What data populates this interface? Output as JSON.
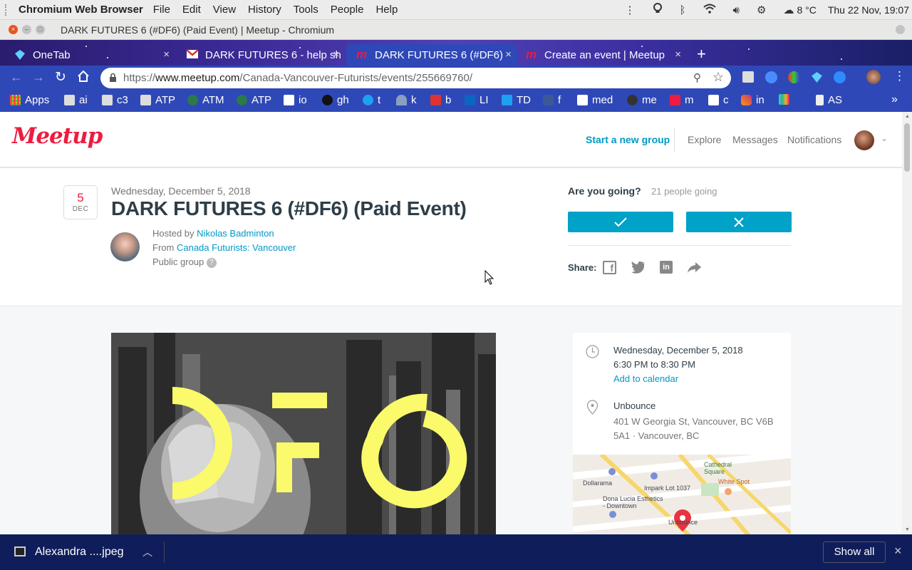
{
  "system": {
    "app_name": "Chromium Web Browser",
    "menus": [
      "File",
      "Edit",
      "View",
      "History",
      "Tools",
      "People",
      "Help"
    ],
    "temperature": "8 °C",
    "datetime": "Thu 22 Nov, 19:07"
  },
  "window": {
    "title": "DARK FUTURES 6 (#DF6) (Paid Event) | Meetup - Chromium"
  },
  "tabs": [
    {
      "label": "OneTab",
      "icon": "onetab-icon",
      "active": false
    },
    {
      "label": "DARK FUTURES 6 - help sh",
      "icon": "gmail-icon",
      "active": false
    },
    {
      "label": "DARK FUTURES 6 (#DF6) (",
      "icon": "meetup-icon",
      "active": true
    },
    {
      "label": "Create an event | Meetup",
      "icon": "meetup-icon",
      "active": false
    }
  ],
  "omnibox": {
    "scheme": "https://",
    "host": "www.meetup.com",
    "path": "/Canada-Vancouver-Futurists/events/255669760/"
  },
  "bookmarks": [
    "Apps",
    "ai",
    "c3",
    "ATP",
    "ATM",
    "ATP",
    "io",
    "gh",
    "t",
    "k",
    "b",
    "LI",
    "TD",
    "f",
    "med",
    "me",
    "m",
    "c",
    "in",
    "",
    "AS"
  ],
  "meetup": {
    "logo": "Meetup",
    "nav": {
      "start_group": "Start a new group",
      "explore": "Explore",
      "messages": "Messages",
      "notifications": "Notifications"
    },
    "event": {
      "date_day": "5",
      "date_month": "DEC",
      "date_line": "Wednesday, December 5, 2018",
      "title": "DARK FUTURES 6 (#DF6) (Paid Event)",
      "hosted_by_label": "Hosted by",
      "host_name": "Nikolas Badminton",
      "from_label": "From",
      "group_name": "Canada Futurists: Vancouver",
      "group_type": "Public group",
      "help_mark": "?"
    },
    "rsvp": {
      "question": "Are you going?",
      "count": "21 people going",
      "share_label": "Share:"
    },
    "info": {
      "date": "Wednesday, December 5, 2018",
      "time": "6:30 PM to 8:30 PM",
      "add_calendar": "Add to calendar",
      "venue": "Unbounce",
      "address": "401 W Georgia St, Vancouver, BC V6B 5A1 · Vancouver, BC"
    },
    "map_labels": {
      "cathedral": "Cathedral Square",
      "dollarama": "Dollarama",
      "white_spot": "White Spot",
      "impark": "Impark Lot 1037",
      "dona_lucia": "Dona Lucia Esthetics - Downtown",
      "unbounce": "Unbounce"
    }
  },
  "download": {
    "filename": "Alexandra ....jpeg",
    "show_all": "Show all"
  },
  "colors": {
    "meetup_red": "#ed1c40",
    "meetup_blue": "#00a2c7",
    "link_blue": "#0099c5",
    "chrome_blue": "#2f48b7",
    "download_bar": "#0f1e5a"
  }
}
